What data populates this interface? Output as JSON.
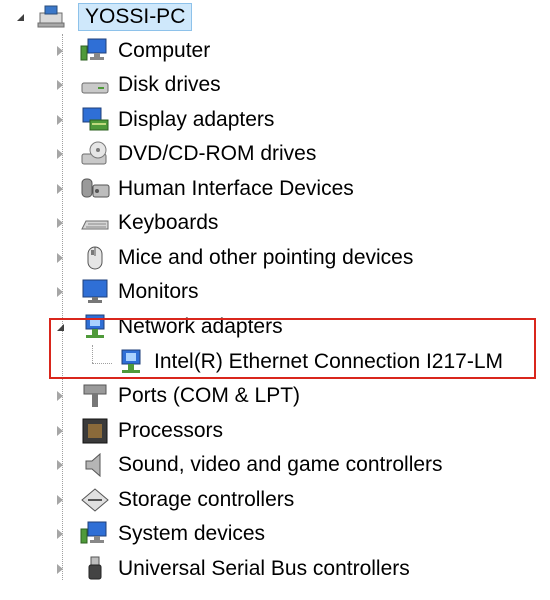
{
  "root": {
    "label": "YOSSI-PC",
    "icon": "computer-icon"
  },
  "items": [
    {
      "label": "Computer",
      "icon": "computer-icon",
      "expanded": false
    },
    {
      "label": "Disk drives",
      "icon": "disk-drive-icon",
      "expanded": false
    },
    {
      "label": "Display adapters",
      "icon": "display-adapter-icon",
      "expanded": false
    },
    {
      "label": "DVD/CD-ROM drives",
      "icon": "dvd-drive-icon",
      "expanded": false
    },
    {
      "label": "Human Interface Devices",
      "icon": "hid-icon",
      "expanded": false
    },
    {
      "label": "Keyboards",
      "icon": "keyboard-icon",
      "expanded": false
    },
    {
      "label": "Mice and other pointing devices",
      "icon": "mouse-icon",
      "expanded": false
    },
    {
      "label": "Monitors",
      "icon": "monitor-icon",
      "expanded": false
    },
    {
      "label": "Network adapters",
      "icon": "network-adapter-icon",
      "expanded": true,
      "children": [
        {
          "label": "Intel(R) Ethernet Connection I217-LM",
          "icon": "network-adapter-icon"
        }
      ]
    },
    {
      "label": "Ports (COM & LPT)",
      "icon": "port-icon",
      "expanded": false
    },
    {
      "label": "Processors",
      "icon": "processor-icon",
      "expanded": false
    },
    {
      "label": "Sound, video and game controllers",
      "icon": "speaker-icon",
      "expanded": false
    },
    {
      "label": "Storage controllers",
      "icon": "storage-controller-icon",
      "expanded": false
    },
    {
      "label": "System devices",
      "icon": "system-device-icon",
      "expanded": false
    },
    {
      "label": "Universal Serial Bus controllers",
      "icon": "usb-icon",
      "expanded": false
    }
  ],
  "colors": {
    "highlight_border": "#d9261c",
    "root_selection": "#cfe8fb"
  }
}
